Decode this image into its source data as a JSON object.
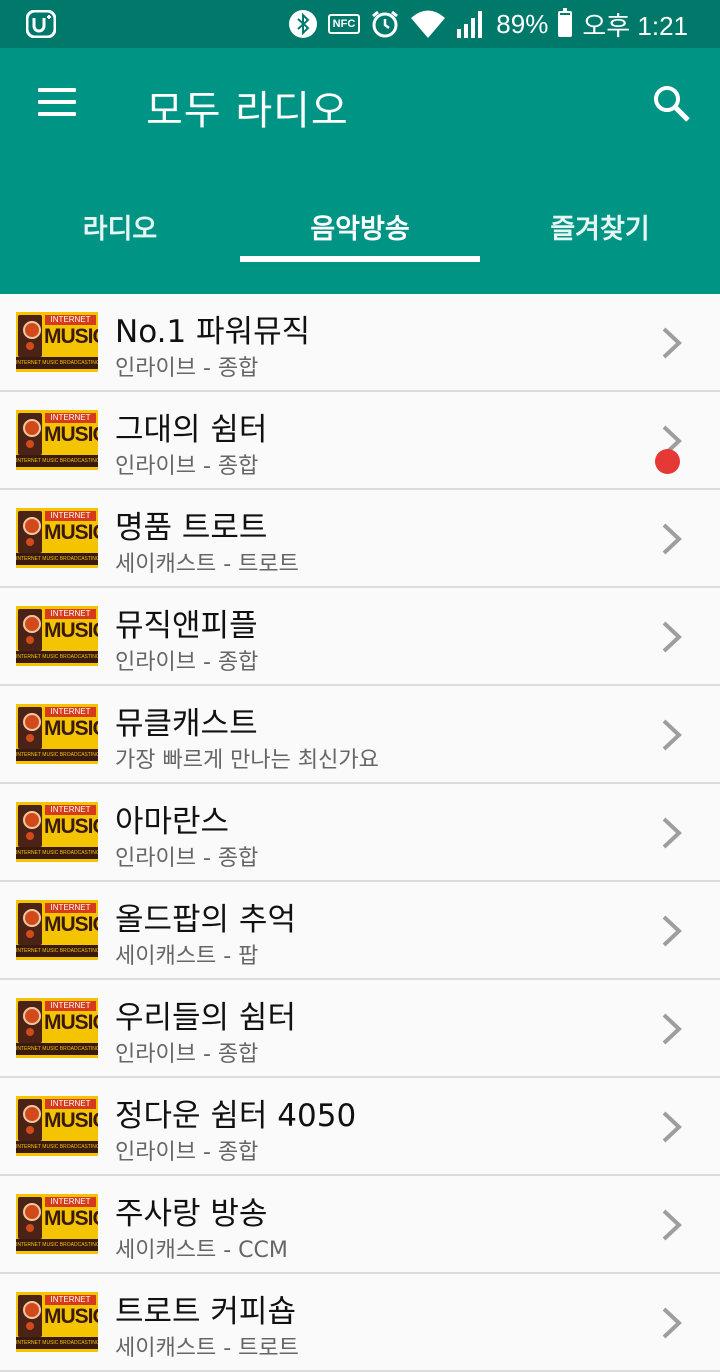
{
  "status_bar": {
    "battery_percent": "89%",
    "battery_level": 0.89,
    "time": "오후 1:21",
    "icons": [
      "app-logo-icon",
      "bluetooth-icon",
      "nfc-icon",
      "alarm-icon",
      "wifi-icon",
      "signal-icon",
      "battery-icon"
    ],
    "nfc_label": "NFC"
  },
  "app_bar": {
    "title": "모두 라디오",
    "menu_icon": "menu-icon",
    "search_icon": "search-icon"
  },
  "tabs": [
    {
      "label": "라디오",
      "active": false
    },
    {
      "label": "음악방송",
      "active": true
    },
    {
      "label": "즐겨찾기",
      "active": false
    }
  ],
  "thumbnail": {
    "line1": "INTERNET",
    "line2": "MUSIC",
    "line3": "INTERNET MUSIC BROADCASTING"
  },
  "list": [
    {
      "title": "No.1 파워뮤직",
      "subtitle": "인라이브 - 종합"
    },
    {
      "title": "그대의 쉼터",
      "subtitle": "인라이브 - 종합",
      "playing_indicator": true
    },
    {
      "title": "명품 트로트",
      "subtitle": "세이캐스트 - 트로트"
    },
    {
      "title": "뮤직앤피플",
      "subtitle": "인라이브 - 종합"
    },
    {
      "title": "뮤클캐스트",
      "subtitle": "가장 빠르게 만나는 최신가요"
    },
    {
      "title": "아마란스",
      "subtitle": "인라이브 - 종합"
    },
    {
      "title": "올드팝의 추억",
      "subtitle": "세이캐스트 - 팝"
    },
    {
      "title": "우리들의 쉼터",
      "subtitle": "인라이브 - 종합"
    },
    {
      "title": "정다운 쉼터 4050",
      "subtitle": "인라이브 - 종합"
    },
    {
      "title": "주사랑 방송",
      "subtitle": "세이캐스트 - CCM"
    },
    {
      "title": "트로트 커피숍",
      "subtitle": "세이캐스트 - 트로트"
    }
  ],
  "colors": {
    "status_bar": "#00796b",
    "app_bar": "#009485",
    "accent_dot": "#e53935",
    "thumb_bg": "#f5c400"
  }
}
